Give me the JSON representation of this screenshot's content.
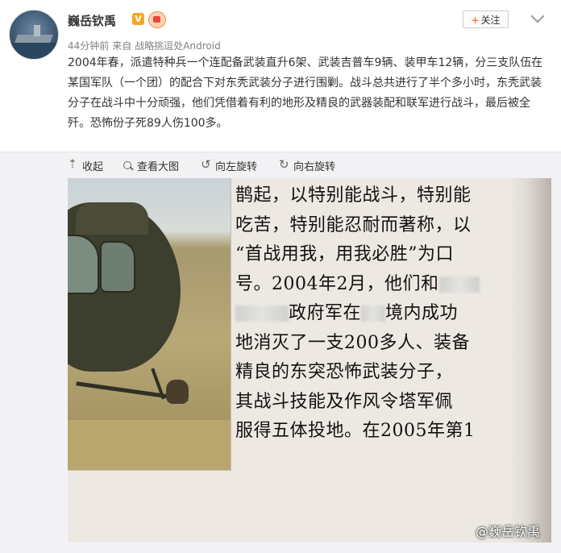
{
  "author": {
    "name": "巍岳钦禹",
    "verified_badge": "V"
  },
  "meta": {
    "time": "44分钟前",
    "source_prefix": "来自",
    "source": "战略挑逗处Android"
  },
  "follow_button": {
    "plus": "+",
    "label": "关注"
  },
  "post": {
    "text": "2004年春，派遣特种兵一个连配备武装直升6架、武装吉普车9辆、装甲车12辆，分三支队伍在某国军队（一个团）的配合下对东秃武装分子进行围剿。战斗总共进行了半个多小时，东秃武装分子在战斗中十分顽强，他们凭借着有利的地形及精良的武器装配和联军进行战斗，最后被全歼。恐怖份子死89人伤100多。"
  },
  "toolbar": {
    "collapse": "收起",
    "view_large": "查看大图",
    "rotate_left": "向左旋转",
    "rotate_right": "向右旋转"
  },
  "photo": {
    "lines": [
      "鹊起，以特别能战斗，特别能",
      "吃苦，特别能忍耐而著称，以",
      "“首战用我，用我必胜”为口",
      "号。2004年2月，他们和",
      "政府军在",
      "境内成功",
      "地消灭了一支200多人、装备",
      "精良的东突恐怖武装分子，",
      "其战斗技能及作风令塔军佩",
      "服得五体投地。在2005年第1"
    ],
    "watermark": "@巍岳钦禹"
  },
  "colors": {
    "accent_orange": "#fa7d3c",
    "verified": "#f5a623",
    "toolbar_bg": "#f2f2f5",
    "meta_gray": "#808080"
  }
}
